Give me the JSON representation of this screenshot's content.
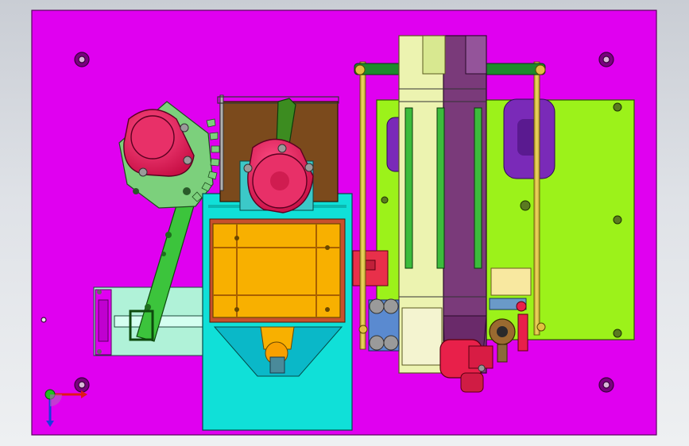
{
  "viewport": {
    "label": "",
    "view": "front"
  },
  "colors": {
    "plate": "#e000f0",
    "green_plate": "#9cf21a",
    "teal_body": "#10e0d8",
    "gold_block": "#f8b000",
    "brown_panel": "#7b4a1c",
    "crimson_cam": "#e8205a",
    "yellow_rail": "#e0d080",
    "cream_column": "#ecf3b0",
    "purple_column": "#7a3a7a",
    "lever_green": "#3cc43c",
    "gear_green": "#7cd07c",
    "violet_pads": "#7a2ab8",
    "axis_x": "#e01818",
    "axis_y": "#20c020",
    "axis_z": "#1a3ae0"
  },
  "parts": [
    "base-plate",
    "spring-plate",
    "mechanism-body",
    "arc-chute",
    "drive-cam",
    "gear-sector",
    "drive-lever",
    "guide-bar",
    "moving-contact-column",
    "tie-rod",
    "motor"
  ],
  "triad": {
    "axes": [
      "X",
      "Y",
      "Z"
    ]
  }
}
